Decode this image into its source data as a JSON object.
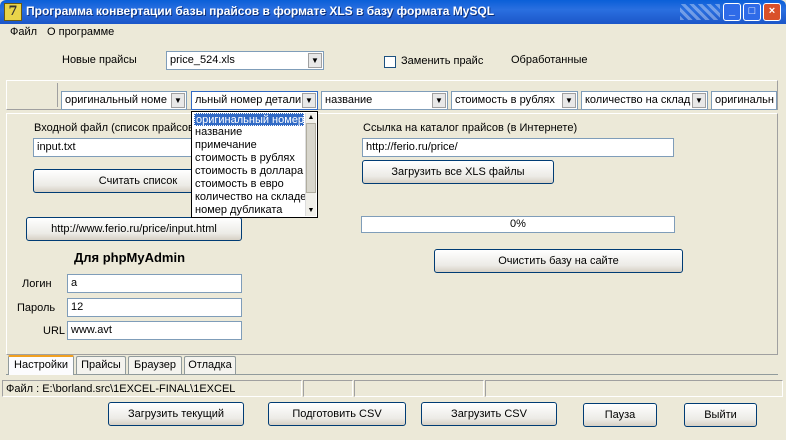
{
  "window": {
    "title": "Программа конвертации базы прайсов в формате XLS в базу формата MySQL"
  },
  "menu": [
    "Файл",
    "О программе"
  ],
  "top": {
    "new_prices_label": "Новые прайсы",
    "new_prices_value": "price_524.xls",
    "replace_label": "Заменить прайс",
    "processed_label": "Обработанные"
  },
  "columns": [
    "оригинальный номе",
    "льный номер детали",
    "название",
    "стоимость в рублях",
    "количество на склад",
    "оригинальны"
  ],
  "dropdown_options": [
    "оригинальный номер",
    "название",
    "примечание",
    "стоимость в рублях",
    "стоимость в доллара",
    "стоимость в евро",
    "количество на складе",
    "номер дубликата"
  ],
  "settings": {
    "input_file_label": "Входной файл (список прайсов",
    "input_file_value": "input.txt",
    "read_list_label": "Считать список",
    "input_url_label": "http://www.ferio.ru/price/input.html",
    "catalog_label": "Ссылка на каталог прайсов (в Интернете)",
    "catalog_value": "http://ferio.ru/price/",
    "load_all_label": "Загрузить все XLS файлы",
    "progress_text": "0%",
    "progress_value": 0,
    "clear_db_label": "Очистить базу на сайте",
    "phpmyadmin_heading": "Для phpMyAdmin",
    "login_label": "Логин",
    "login_value": "a",
    "password_label": "Пароль",
    "password_value": "12",
    "url_label": "URL",
    "url_value": "www.avt"
  },
  "tabs": [
    "Настройки",
    "Прайсы",
    "Браузер",
    "Отладка"
  ],
  "status": {
    "file_text": "Файл : E:\\borland.src\\1EXCEL-FINAL\\1EXCEL"
  },
  "bottom_buttons": {
    "load_current": "Загрузить текущий",
    "prepare_csv": "Подготовить CSV",
    "load_csv": "Загрузить CSV",
    "pause": "Пауза",
    "exit": "Выйти"
  }
}
